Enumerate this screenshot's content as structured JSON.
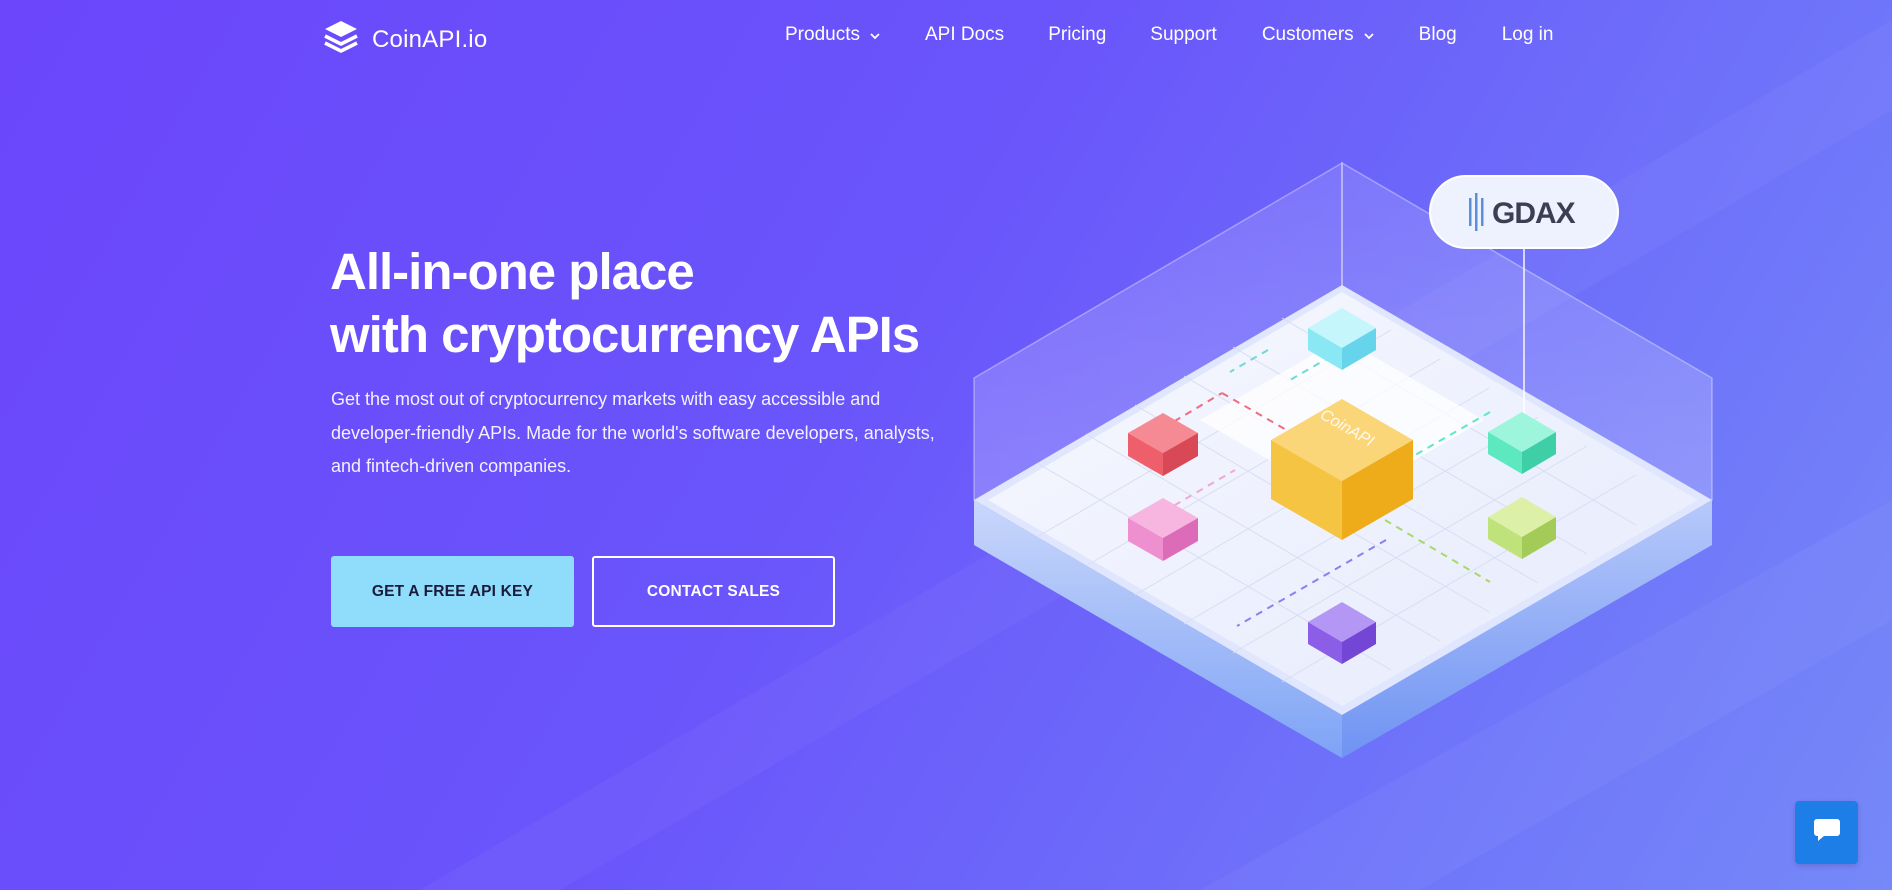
{
  "header": {
    "logo_text": "CoinAPI.io",
    "logo_icon": "stacked-layers-icon",
    "nav": [
      {
        "label": "Products",
        "dropdown": true
      },
      {
        "label": "API Docs",
        "dropdown": false
      },
      {
        "label": "Pricing",
        "dropdown": false
      },
      {
        "label": "Support",
        "dropdown": false
      },
      {
        "label": "Customers",
        "dropdown": true
      },
      {
        "label": "Blog",
        "dropdown": false
      },
      {
        "label": "Log in",
        "dropdown": false
      }
    ]
  },
  "hero": {
    "title_line1": "All-in-one place",
    "title_line2": "with cryptocurrency APIs",
    "description": "Get the most out of cryptocurrency markets with easy accessible and developer-friendly APIs. Made for the world's software developers, analysts, and fintech-driven companies.",
    "primary_cta": "GET A FREE API KEY",
    "secondary_cta": "CONTACT SALES"
  },
  "illustration": {
    "center_cube_label": "CoinAPI",
    "exchange_badge": "GDAX",
    "colors": {
      "center": "#f6c443",
      "cyan": "#8ae8f5",
      "red": "#ef5f6b",
      "green": "#5de8c0",
      "pink": "#ee8fcf",
      "lime": "#bfe27a",
      "purple": "#8c5ee8"
    }
  },
  "chat": {
    "icon": "chat-bubble-icon"
  },
  "colors": {
    "background": "#6b4cfb",
    "primary_button": "#8fdcfb",
    "chat_button": "#1e7ee8"
  }
}
